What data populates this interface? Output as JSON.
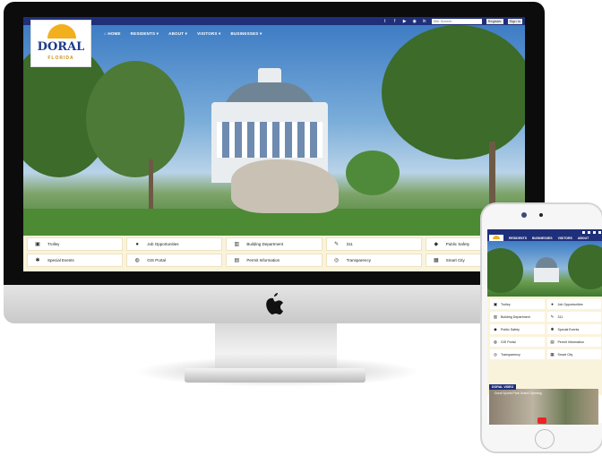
{
  "desktop": {
    "logo": {
      "word": "DORAL",
      "sub": "FLORIDA"
    },
    "nav": [
      "⌂ HOME",
      "RESIDENTS ▾",
      "ABOUT ▾",
      "VISITORS ▾",
      "BUSINESSES ▾"
    ],
    "search_placeholder": "Site Search",
    "register_label": "Register",
    "signin_label": "Sign In",
    "quick_links": [
      {
        "icon": "bus-icon",
        "glyph": "▣",
        "label": "Trolley"
      },
      {
        "icon": "person-icon",
        "glyph": "●",
        "label": "Job Opportunities"
      },
      {
        "icon": "building-icon",
        "glyph": "▥",
        "label": "Building Department"
      },
      {
        "icon": "edit-icon",
        "glyph": "✎",
        "label": "311"
      },
      {
        "icon": "shield-icon",
        "glyph": "◆",
        "label": "Public Safety"
      },
      {
        "icon": "star-icon",
        "glyph": "✱",
        "label": "Special Events"
      },
      {
        "icon": "globe-icon",
        "glyph": "◍",
        "label": "GIS Portal"
      },
      {
        "icon": "document-icon",
        "glyph": "▤",
        "label": "Permit Information"
      },
      {
        "icon": "eye-slash-icon",
        "glyph": "◎",
        "label": "Transparency"
      },
      {
        "icon": "bank-icon",
        "glyph": "▦",
        "label": "Smart City"
      }
    ]
  },
  "mobile": {
    "nav": [
      "RESIDENTS",
      "BUSINESSES",
      "VISITORS",
      "ABOUT"
    ],
    "quick_links": [
      {
        "icon": "bus-icon",
        "glyph": "▣",
        "label": "Trolley"
      },
      {
        "icon": "person-icon",
        "glyph": "●",
        "label": "Job Opportunities"
      },
      {
        "icon": "building-icon",
        "glyph": "▥",
        "label": "Building Department"
      },
      {
        "icon": "edit-icon",
        "glyph": "✎",
        "label": "311"
      },
      {
        "icon": "shield-icon",
        "glyph": "◆",
        "label": "Public Safety"
      },
      {
        "icon": "star-icon",
        "glyph": "✱",
        "label": "Special Events"
      },
      {
        "icon": "globe-icon",
        "glyph": "◍",
        "label": "GIS Portal"
      },
      {
        "icon": "document-icon",
        "glyph": "▤",
        "label": "Permit Information"
      },
      {
        "icon": "eye-slash-icon",
        "glyph": "◎",
        "label": "Transparency"
      },
      {
        "icon": "bank-icon",
        "glyph": "▦",
        "label": "Smart City"
      }
    ],
    "video_section_label": "DORAL VIDEO",
    "video_title": "Doral Sports Park Grand Opening"
  },
  "colors": {
    "navy": "#1f2f7a",
    "gold": "#f2b01e",
    "cream": "#faf3dc"
  }
}
